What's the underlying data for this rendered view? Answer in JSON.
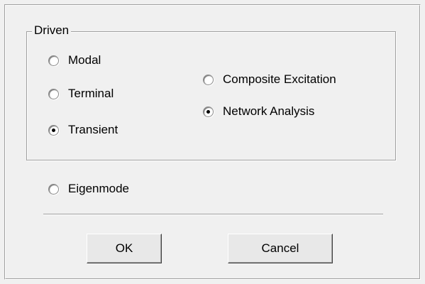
{
  "group": {
    "label": "Driven"
  },
  "options": {
    "modal": {
      "label": "Modal",
      "checked": false
    },
    "terminal": {
      "label": "Terminal",
      "checked": false
    },
    "transient": {
      "label": "Transient",
      "checked": true
    },
    "composite": {
      "label": "Composite Excitation",
      "checked": false
    },
    "network": {
      "label": "Network Analysis",
      "checked": true
    },
    "eigenmode": {
      "label": "Eigenmode",
      "checked": false
    }
  },
  "buttons": {
    "ok": "OK",
    "cancel": "Cancel"
  }
}
